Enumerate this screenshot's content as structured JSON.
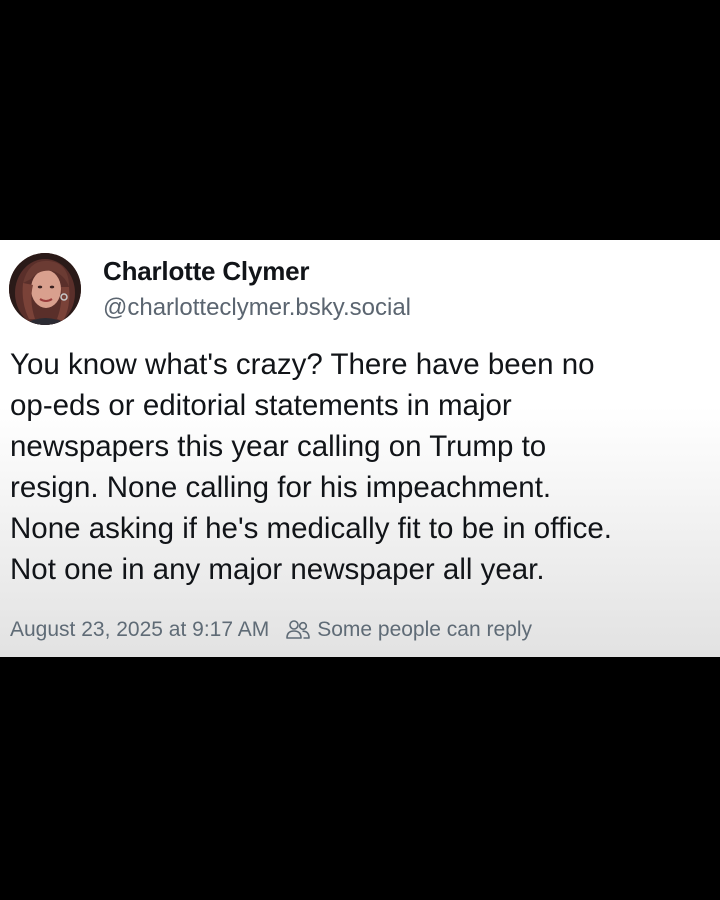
{
  "post": {
    "author": {
      "display_name": "Charlotte Clymer",
      "handle": "@charlotteclymer.bsky.social"
    },
    "body_lines": [
      "You know what's crazy? There have been no",
      "op-eds or editorial statements in major",
      "newspapers this year calling on Trump to",
      "resign. None calling for his impeachment.",
      "None asking if he's medically fit to be in office.",
      "Not one in any major newspaper all year."
    ],
    "timestamp": "August 23, 2025 at 9:17 AM",
    "reply_setting": "Some people can reply",
    "reply_icon": "people-icon"
  },
  "colors": {
    "background": "#000000",
    "card": "#ffffff",
    "text_primary": "#111418",
    "text_secondary": "#5b6570"
  }
}
